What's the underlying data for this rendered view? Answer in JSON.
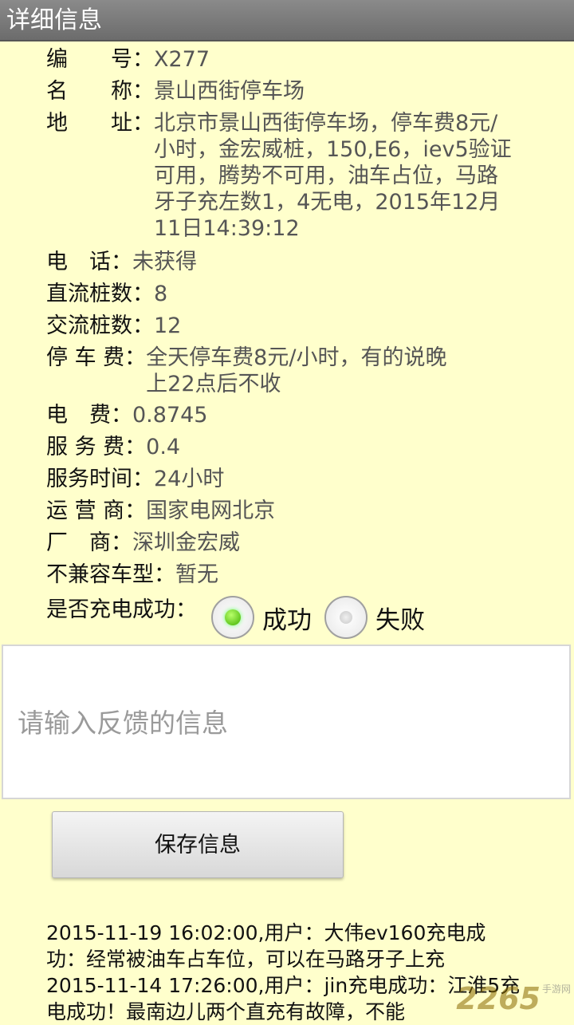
{
  "title": "详细信息",
  "fields": {
    "id": {
      "label": "编　　号：",
      "value": "X277"
    },
    "name": {
      "label": "名　　称：",
      "value": "景山西街停车场"
    },
    "address": {
      "label": "地　　址：",
      "value": "北京市景山西街停车场，停车费8元/小时，金宏威桩，150,E6，iev5验证可用，腾势不可用，油车占位，马路牙子充左数1，4无电，2015年12月11日14:39:12"
    },
    "phone": {
      "label": "电　话：",
      "value": "未获得"
    },
    "dc": {
      "label": "直流桩数：",
      "value": "8"
    },
    "ac": {
      "label": "交流桩数：",
      "value": "12"
    },
    "parking": {
      "label": "停 车 费：",
      "value": "全天停车费8元/小时，有的说晚上22点后不收"
    },
    "elec_fee": {
      "label": "电　费：",
      "value": "0.8745"
    },
    "service_fee": {
      "label": "服 务 费：",
      "value": "0.4"
    },
    "service_time": {
      "label": "服务时间：",
      "value": "24小时"
    },
    "operator": {
      "label": "运 营 商：",
      "value": "国家电网北京"
    },
    "vendor": {
      "label": "厂　商：",
      "value": "深圳金宏威"
    },
    "incompatible": {
      "label": "不兼容车型：",
      "value": "暂无"
    }
  },
  "charge_result": {
    "label": "是否充电成功：",
    "success": "成功",
    "fail": "失败",
    "selected": "success"
  },
  "feedback": {
    "placeholder": "请输入反馈的信息"
  },
  "save_label": "保存信息",
  "log": {
    "entries": [
      "2015-11-19 16:02:00,用户：大伟ev160充电成功：经常被油车占车位，可以在马路牙子上充",
      "2015-11-14 17:26:00,用户：jin充电成功：江淮5充电成功！最南边儿两个直充有故障，不能"
    ]
  },
  "watermark": {
    "logo": "2265",
    "sub": "手游网"
  }
}
